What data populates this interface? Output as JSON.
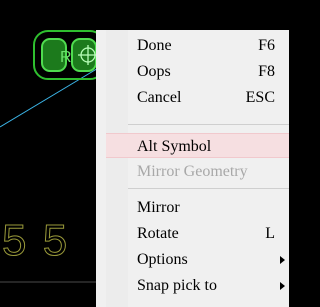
{
  "context_menu": {
    "items": [
      {
        "label": "Done",
        "shortcut": "F6",
        "enabled": true,
        "highlighted": false
      },
      {
        "label": "Oops",
        "shortcut": "F8",
        "enabled": true,
        "highlighted": false
      },
      {
        "label": "Cancel",
        "shortcut": "ESC",
        "enabled": true,
        "highlighted": false
      },
      {
        "label": "Alt Symbol",
        "shortcut": "",
        "enabled": true,
        "highlighted": true
      },
      {
        "label": "Mirror Geometry",
        "shortcut": "",
        "enabled": false,
        "highlighted": false
      },
      {
        "label": "Mirror",
        "shortcut": "",
        "enabled": true,
        "highlighted": false
      },
      {
        "label": "Rotate",
        "shortcut": "L",
        "enabled": true,
        "highlighted": false
      },
      {
        "label": "Options",
        "shortcut": "",
        "enabled": true,
        "highlighted": false,
        "submenu": true
      },
      {
        "label": "Snap pick to",
        "shortcut": "",
        "enabled": true,
        "highlighted": false,
        "submenu": true
      }
    ]
  },
  "canvas": {
    "background_color": "#000000",
    "part_label": "R",
    "silkscreen_text": "5 5",
    "colors": {
      "component_outline": "#2fbf2f",
      "ratsnest_line": "#3bb4e6",
      "silkscreen": "#9a9a3a",
      "highlight": "#f6dfe1"
    },
    "icons": [
      "crosshair-icon"
    ]
  }
}
